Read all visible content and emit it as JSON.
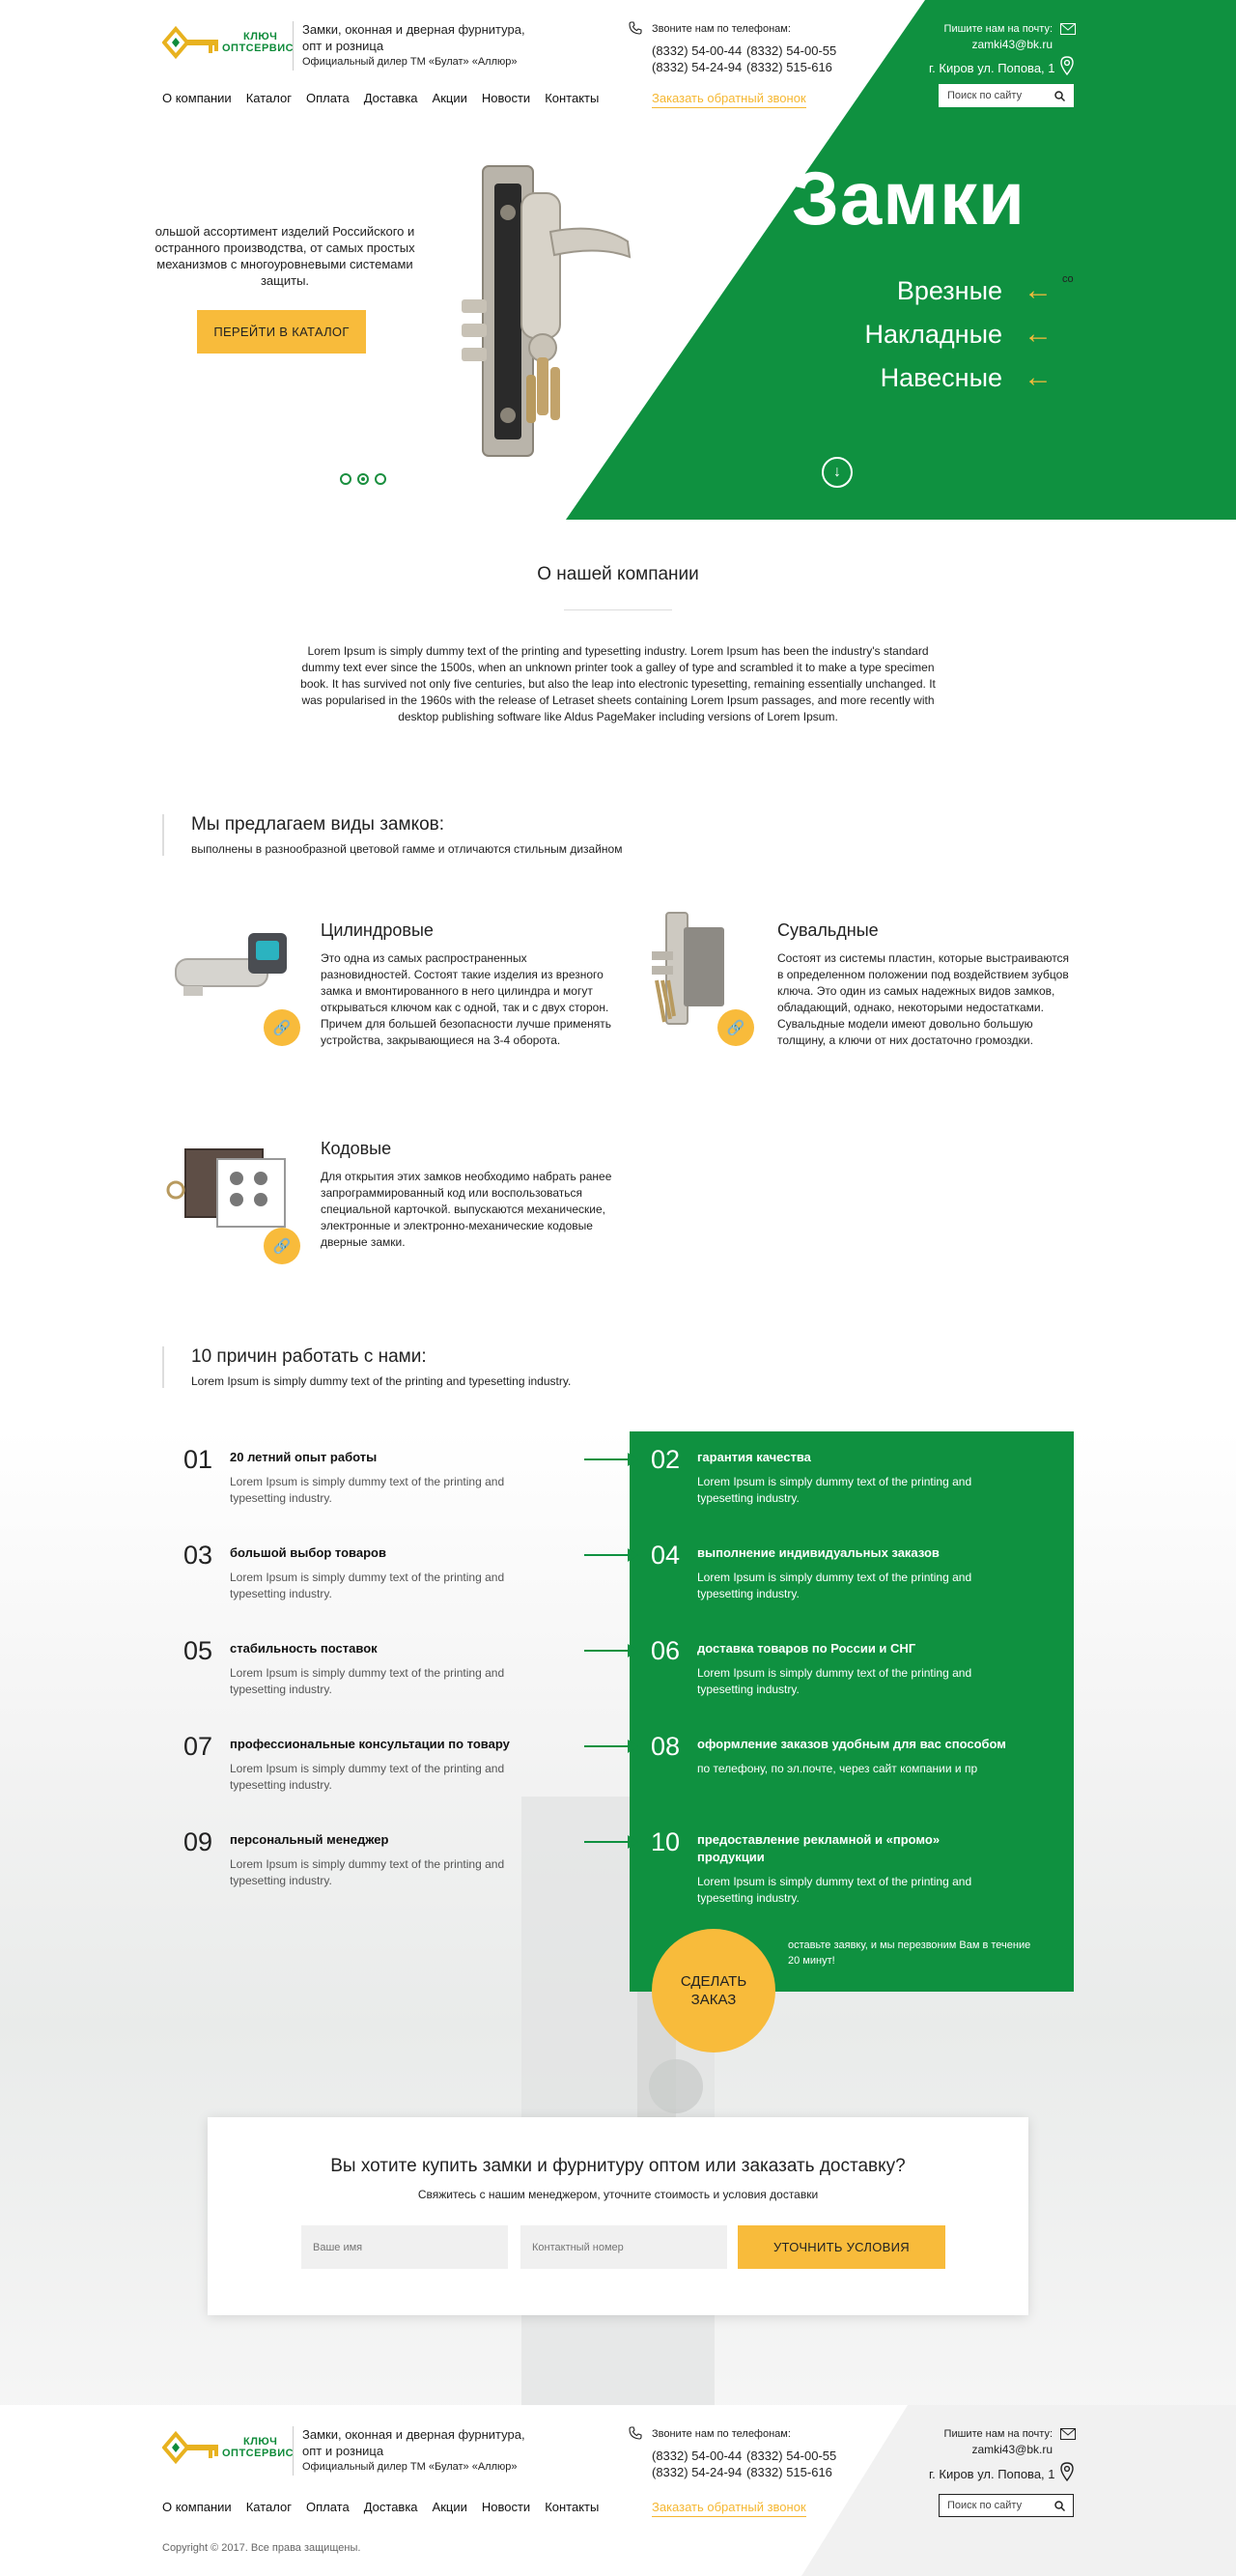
{
  "header": {
    "logo": {
      "line1": "КЛЮЧ",
      "line2": "ОПТСЕРВИС"
    },
    "tagline": {
      "line1": "Замки, оконная и дверная фурнитура,",
      "line2": "опт и розница",
      "line3": "Официальный дилер ТМ «Булат» «Аллюр»"
    },
    "phones_title": "Звоните нам по телефонам:",
    "phones": [
      "(8332) 54-00-44",
      "(8332) 54-00-55",
      "(8332) 54-24-94",
      "(8332) 515-616"
    ],
    "callback": "Заказать обратный звонок",
    "mail_label": "Пишите нам на почту:",
    "mail": "zamki43@bk.ru",
    "address": "г. Киров ул. Попова, 1",
    "search_placeholder": "Поиск по сайту",
    "nav": [
      "О компании",
      "Каталог",
      "Оплата",
      "Доставка",
      "Акции",
      "Новости",
      "Контакты"
    ]
  },
  "hero": {
    "copy_line1": "ольшой ассортимент изделий Российского и",
    "copy_line2": "остранного производства, от самых простых",
    "copy_line3": "механизмов с многоуровневыми системами",
    "copy_line4": "защиты.",
    "catalog_button": "ПЕРЕЙТИ В КАТАЛОГ",
    "title": "Замки",
    "links": [
      "Врезные",
      "Накладные",
      "Навесные"
    ],
    "side_fragment": "co",
    "slide_count": 3,
    "active_slide": 2
  },
  "about": {
    "title": "О нашей компании",
    "text": "Lorem Ipsum is simply dummy text of the printing and typesetting industry. Lorem Ipsum has been the industry's standard dummy text ever since the 1500s, when an unknown printer took a galley of type and scrambled it to make a type specimen book. It has survived not only five centuries, but also the leap into electronic typesetting, remaining essentially unchanged. It was popularised in the 1960s with the release of Letraset sheets containing Lorem Ipsum passages, and more recently with desktop publishing software like Aldus PageMaker including versions of Lorem Ipsum."
  },
  "locks_section": {
    "title": "Мы предлагаем виды замков:",
    "subtitle": "выполнены в разнообразной цветовой гамме и отличаются стильным дизайном",
    "items": [
      {
        "title": "Цилиндровые",
        "desc": "Это одна из самых распространенных разновидностей. Состоят такие изделия из врезного замка и вмонтированного в него цилиндра и могут открываться ключом как с одной, так и с двух сторон. Причем для большей безопасности лучше применять устройства, закрывающиеся на 3-4 оборота."
      },
      {
        "title": "Сувальдные",
        "desc": "Состоят из системы пластин, которые выстраиваются в определенном положении под воздействием зубцов ключа. Это один из самых надежных видов замков, обладающий, однако, некоторыми недостатками. Сувальдные модели имеют довольно большую толщину, а ключи от них достаточно громоздки."
      },
      {
        "title": "Кодовые",
        "desc": "Для открытия этих замков необходимо набрать ранее запрограммированный код или воспользоваться специальной карточкой. выпускаются механические, электронные и электронно-механические кодовые дверные замки."
      }
    ]
  },
  "reasons": {
    "title": "10 причин работать с нами:",
    "subtitle": "Lorem Ipsum is simply dummy text of the printing and typesetting industry.",
    "items": [
      {
        "num": "01",
        "title": "20 летний опыт работы",
        "desc": "Lorem Ipsum is simply dummy text of the printing and typesetting industry."
      },
      {
        "num": "02",
        "title": "гарантия качества",
        "desc": "Lorem Ipsum is simply dummy text of the printing and typesetting industry."
      },
      {
        "num": "03",
        "title": "большой выбор товаров",
        "desc": "Lorem Ipsum is simply dummy text of the printing and typesetting industry."
      },
      {
        "num": "04",
        "title": "выполнение индивидуальных заказов",
        "desc": "Lorem Ipsum is simply dummy text of the printing and typesetting industry."
      },
      {
        "num": "05",
        "title": "стабильность поставок",
        "desc": "Lorem Ipsum is simply dummy text of the printing and typesetting industry."
      },
      {
        "num": "06",
        "title": "доставка товаров по России и СНГ",
        "desc": "Lorem Ipsum is simply dummy text of the printing and typesetting industry."
      },
      {
        "num": "07",
        "title": "профессиональные консультации по товару",
        "desc": "Lorem Ipsum is simply dummy text of the printing and typesetting industry."
      },
      {
        "num": "08",
        "title": "оформление заказов удобным для вас способом",
        "desc": "по телефону, по эл.почте, через сайт компании и пр"
      },
      {
        "num": "09",
        "title": "персональный менеджер",
        "desc": "Lorem Ipsum is simply dummy text of the printing and typesetting industry."
      },
      {
        "num": "10",
        "title": "предоставление рекламной и «промо» продукции",
        "desc": "Lorem Ipsum is simply dummy text of the printing and typesetting industry."
      }
    ],
    "order_button_line1": "СДЕЛАТЬ",
    "order_button_line2": "ЗАКАЗ",
    "order_note": "оставьте заявку, и мы перезвоним Вам в течение 20 минут!"
  },
  "form": {
    "title": "Вы хотите купить замки и фурнитуру оптом или заказать доставку?",
    "subtitle": "Свяжитесь с нашим менеджером, уточните стоимость и условия доставки",
    "name_placeholder": "Ваше имя",
    "phone_placeholder": "Контактный номер",
    "submit": "УТОЧНИТЬ УСЛОВИЯ"
  },
  "footer": {
    "copyright": "Copyright © 2017. Все права защищены."
  },
  "colors": {
    "green": "#0f9140",
    "yellow": "#f8bb3b"
  }
}
